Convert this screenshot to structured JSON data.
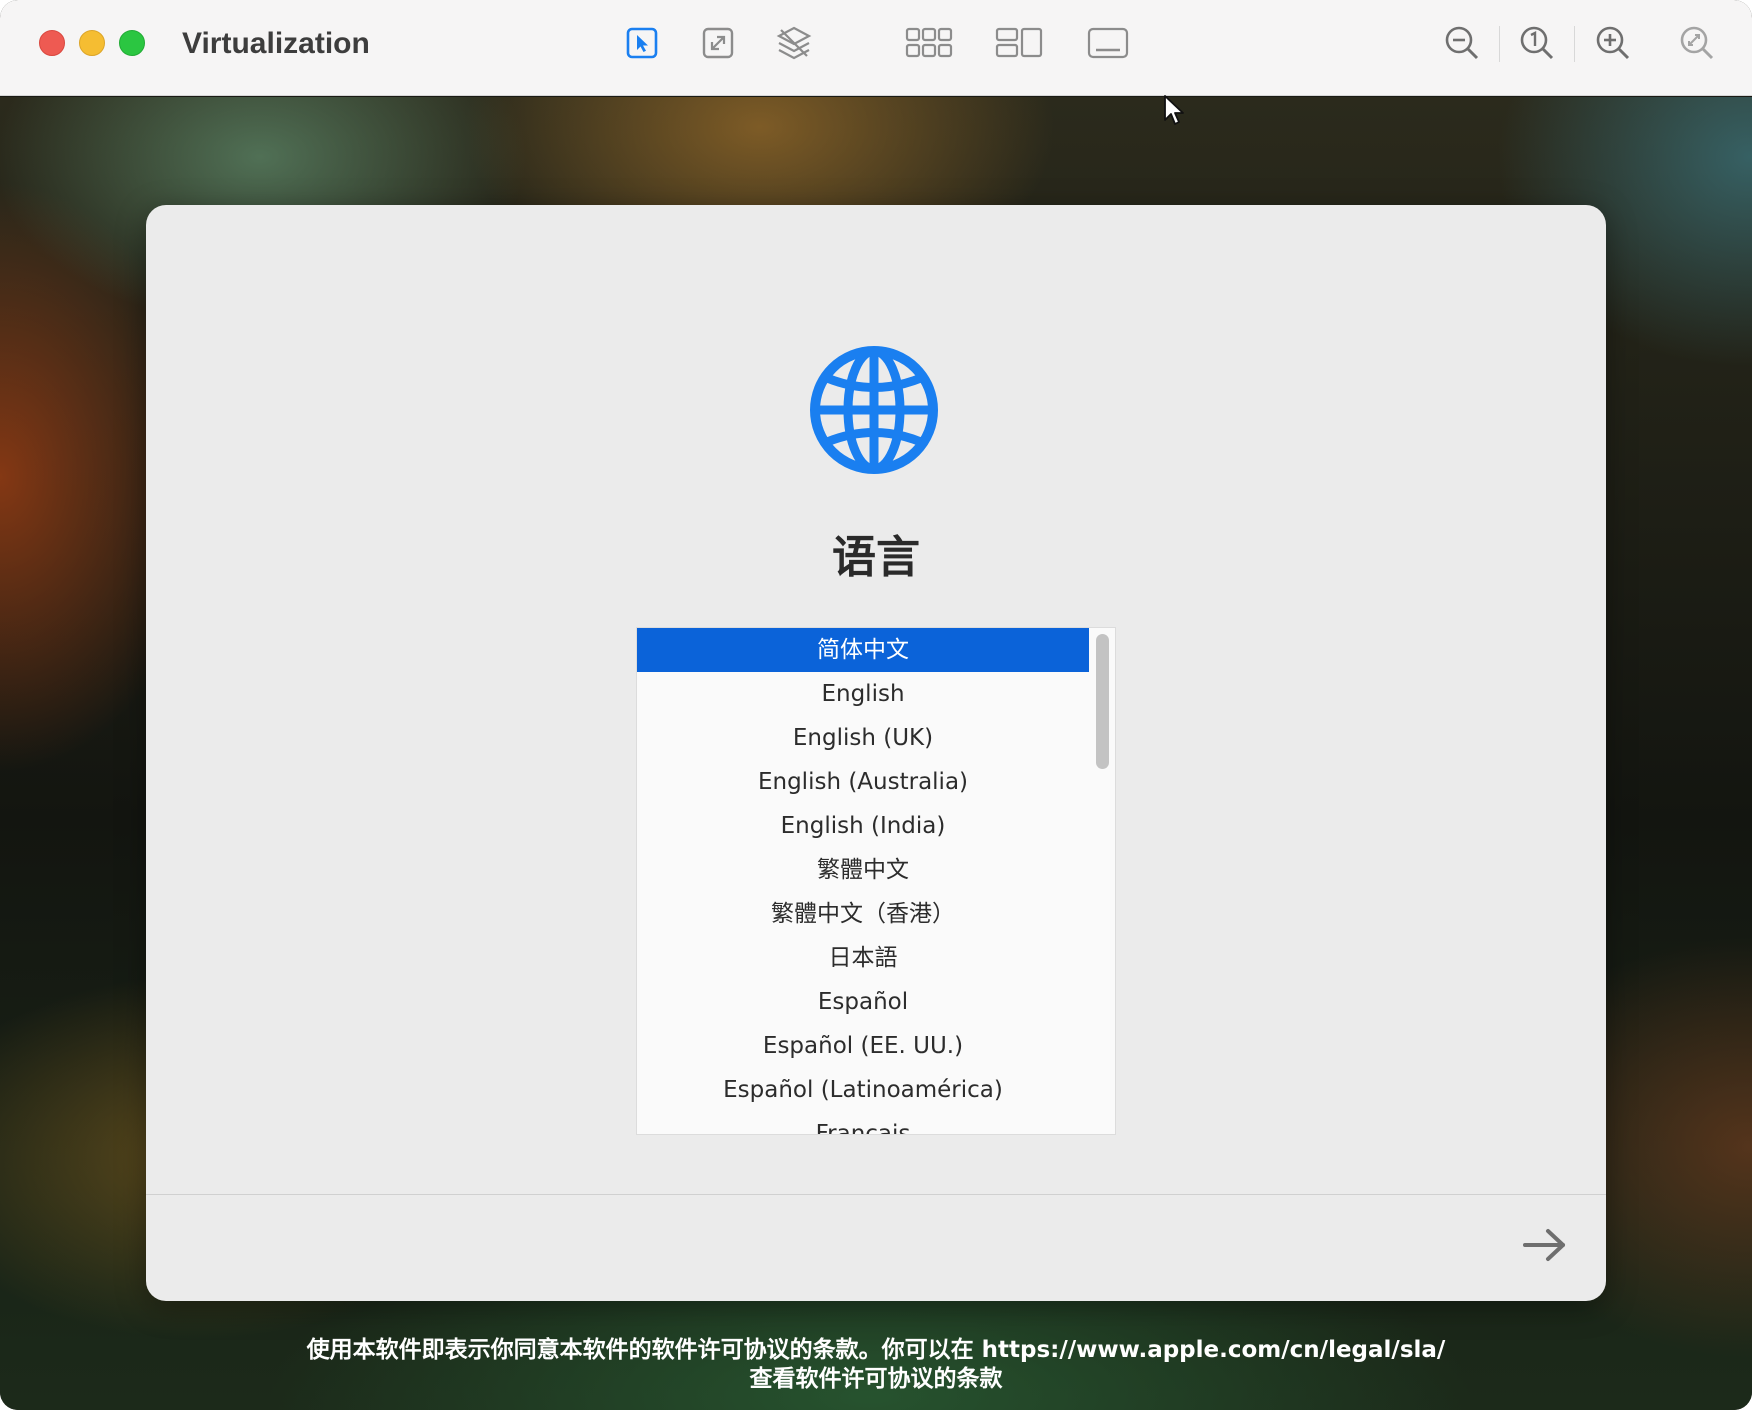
{
  "window": {
    "title": "Virtualization"
  },
  "setup": {
    "title": "语言",
    "languages": [
      "简体中文",
      "English",
      "English (UK)",
      "English (Australia)",
      "English (India)",
      "繁體中文",
      "繁體中文（香港）",
      "日本語",
      "Español",
      "Español (EE. UU.)",
      "Español (Latinoamérica)",
      "Français"
    ],
    "selected_language": "简体中文"
  },
  "footer": {
    "license_line1": "使用本软件即表示你同意本软件的软件许可协议的条款。你可以在 https://www.apple.com/cn/legal/sla/",
    "license_line2": "查看软件许可协议的条款"
  },
  "icons": {
    "toolbar": [
      "pointer-icon",
      "resize-icon",
      "layers-icon",
      "grid-icon",
      "split-view-icon",
      "display-icon",
      "zoom-out-icon",
      "actual-size-icon",
      "zoom-in-icon",
      "zoom-to-fit-icon"
    ],
    "setup": [
      "globe-icon",
      "arrow-right-icon"
    ]
  },
  "colors": {
    "accent": "#0b63d9",
    "globe": "#1a7ff0",
    "traffic_close": "#ee5a52",
    "traffic_minimize": "#f5bd32",
    "traffic_zoom": "#2bc641"
  }
}
